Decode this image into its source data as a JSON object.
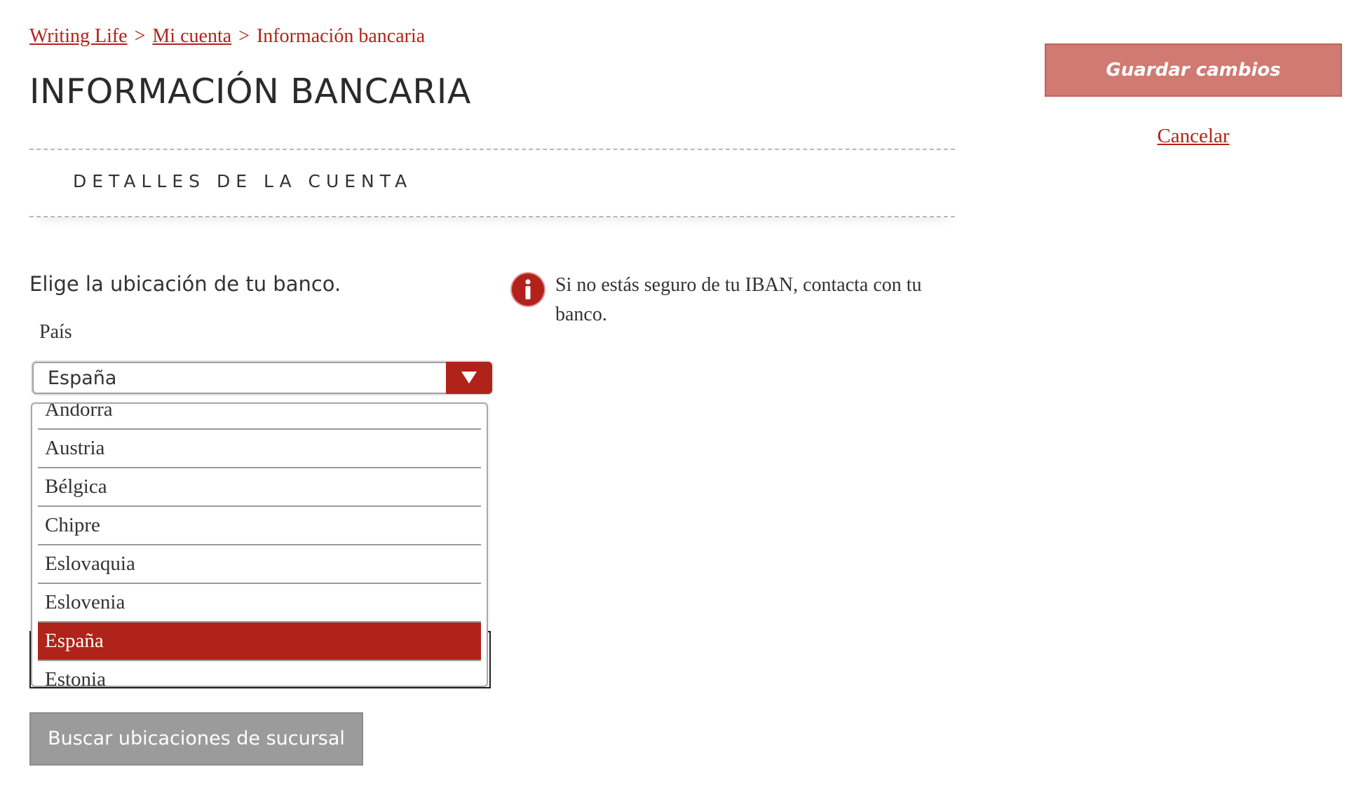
{
  "breadcrumb": {
    "items": [
      "Writing Life",
      "Mi cuenta",
      "Información bancaria"
    ],
    "separator": ">"
  },
  "page_title": "INFORMACIÓN BANCARIA",
  "section": {
    "title": "DETALLES DE LA CUENTA"
  },
  "bank_location": {
    "prompt": "Elige la ubicación de tu banco.",
    "country_label": "País",
    "selected_country": "España",
    "options": [
      "Andorra",
      "Austria",
      "Bélgica",
      "Chipre",
      "Eslovaquia",
      "Eslovenia",
      "España",
      "Estonia"
    ],
    "search_button": "Buscar ubicaciones de sucursal"
  },
  "info": {
    "icon": "info-icon",
    "text": "Si no estás seguro de tu IBAN, contacta con tu banco."
  },
  "actions": {
    "save_label": "Guardar cambios",
    "cancel_label": "Cancelar"
  },
  "colors": {
    "accent": "#b3221a",
    "save_button": "#d07a72",
    "search_button": "#9b9b9b"
  }
}
